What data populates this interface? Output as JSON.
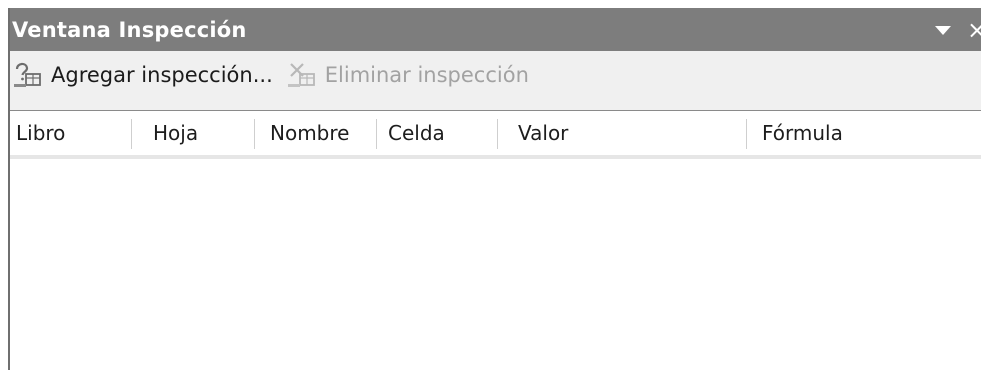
{
  "window": {
    "title": "Ventana Inspección",
    "dropdown_icon": "dropdown-arrow-icon",
    "close_icon": "close-icon",
    "close_glyph": "×"
  },
  "toolbar": {
    "add_label": "Agregar inspección...",
    "add_icon": "add-watch-icon",
    "remove_label": "Eliminar inspección",
    "remove_icon": "delete-watch-icon",
    "remove_enabled": false
  },
  "table": {
    "columns": [
      "Libro",
      "Hoja",
      "Nombre",
      "Celda",
      "Valor",
      "Fórmula"
    ],
    "rows": []
  },
  "colors": {
    "titlebar": "#7d7d7d",
    "toolbar": "#f0f0f0",
    "disabled_text": "#a2a2a2"
  }
}
